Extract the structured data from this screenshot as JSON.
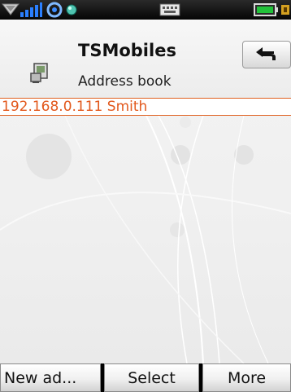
{
  "header": {
    "title": "TSMobiles",
    "subtitle": "Address book"
  },
  "list": {
    "items": [
      {
        "label": "192.168.0.111 Smith"
      }
    ]
  },
  "softkeys": {
    "left": "New ad...",
    "middle": "Select",
    "right": "More"
  },
  "status": {
    "icons": [
      "signal-icon",
      "network-icon",
      "status-dot-icon",
      "keyboard-icon",
      "battery-icon"
    ]
  },
  "colors": {
    "selection": "#e2581c",
    "signal": "#2a7fff"
  }
}
